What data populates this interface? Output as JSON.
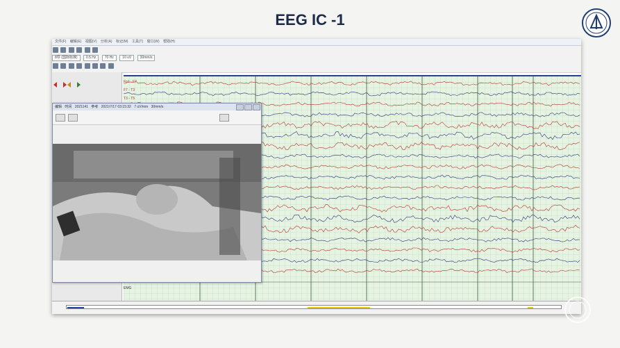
{
  "slide": {
    "title": "EEG IC -1"
  },
  "window": {
    "menu_items": [
      "文件(F)",
      "编辑(E)",
      "视图(V)",
      "分析(A)",
      "标记(M)",
      "工具(T)",
      "窗口(W)",
      "帮助(H)"
    ],
    "toolbar": {
      "montage_select": "8导 (国际标准)",
      "lff_select": "0.5 Hz",
      "hff_select": "70 Hz",
      "sens_select": "10 uV",
      "speed_select": "30mm/s"
    },
    "channels": [
      "Fp1 - F7",
      "F7 - T3",
      "T3 - T5"
    ],
    "bottom_channel": "EMG"
  },
  "video_window": {
    "title_parts": [
      "编辑",
      "时间",
      "2021141",
      "参考",
      "2021/7/17 03:15:32",
      "7 uV/mm",
      "30mm/s"
    ]
  },
  "colors": {
    "grid_bg": "#e6f3e2",
    "red_trace": "#b7322a",
    "blue_trace": "#27357c",
    "header_line": "#2a3f9a",
    "title": "#1d2a4a"
  }
}
